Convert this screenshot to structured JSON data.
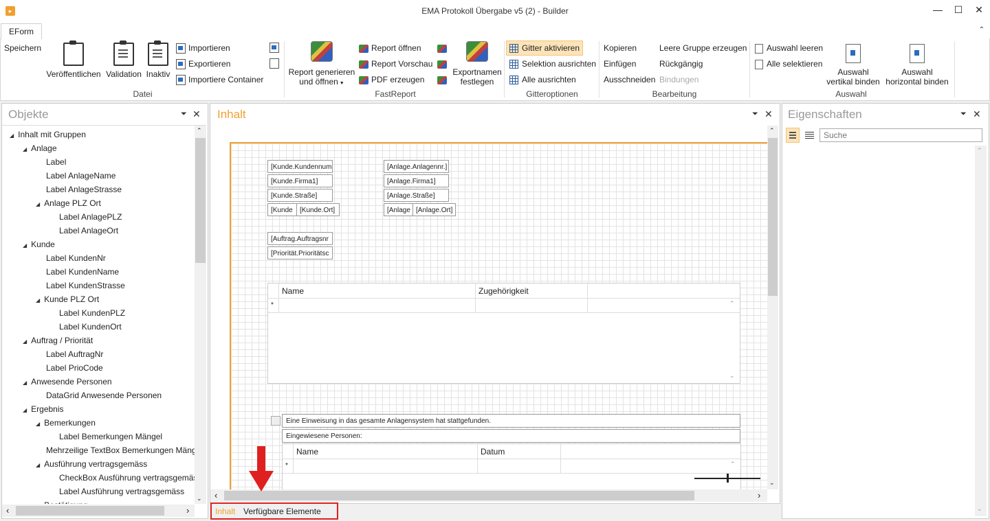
{
  "window": {
    "title": "EMA Protokoll Übergabe v5 (2) - Builder",
    "minimize": "—",
    "maximize": "☐",
    "close": "✕"
  },
  "ribbon": {
    "tab": "EForm",
    "datei": {
      "label": "Datei",
      "speichern": "Speichern",
      "veroeffentlichen": "Veröffentlichen",
      "validation": "Validation",
      "inaktiv": "Inaktiv",
      "importieren": "Importieren",
      "exportieren": "Exportieren",
      "importiere_container": "Importiere Container"
    },
    "fastreport": {
      "label": "FastReport",
      "report_generieren_1": "Report generieren",
      "report_generieren_2": "und öffnen",
      "report_oeffnen": "Report öffnen",
      "report_vorschau": "Report Vorschau",
      "pdf_erzeugen": "PDF erzeugen",
      "exportnamen_1": "Exportnamen",
      "exportnamen_2": "festlegen"
    },
    "gitteroptionen": {
      "label": "Gitteroptionen",
      "gitter_aktivieren": "Gitter aktivieren",
      "selektion_ausrichten": "Selektion ausrichten",
      "alle_ausrichten": "Alle ausrichten"
    },
    "bearbeitung": {
      "label": "Bearbeitung",
      "kopieren": "Kopieren",
      "einfuegen": "Einfügen",
      "ausschneiden": "Ausschneiden",
      "leere_gruppe": "Leere Gruppe erzeugen",
      "rueckgaengig": "Rückgängig",
      "bindungen": "Bindungen"
    },
    "auswahl": {
      "label": "Auswahl",
      "auswahl_leeren": "Auswahl leeren",
      "alle_selektieren": "Alle selektieren",
      "vertikal_1": "Auswahl",
      "vertikal_2": "vertikal binden",
      "horizontal_1": "Auswahl",
      "horizontal_2": "horizontal binden"
    }
  },
  "objekte": {
    "title": "Objekte",
    "items": [
      {
        "label": "Inhalt mit Gruppen",
        "expanded": true
      },
      {
        "label": "Anlage",
        "expanded": true
      },
      {
        "label": "Label"
      },
      {
        "label": "Label AnlageName"
      },
      {
        "label": "Label AnlageStrasse"
      },
      {
        "label": "Anlage PLZ Ort",
        "expanded": true
      },
      {
        "label": "Label AnlagePLZ"
      },
      {
        "label": "Label AnlageOrt"
      },
      {
        "label": "Kunde",
        "expanded": true
      },
      {
        "label": "Label KundenNr"
      },
      {
        "label": "Label KundenName"
      },
      {
        "label": "Label KundenStrasse"
      },
      {
        "label": "Kunde PLZ Ort",
        "expanded": true
      },
      {
        "label": "Label KundenPLZ"
      },
      {
        "label": "Label KundenOrt"
      },
      {
        "label": "Auftrag / Priorität",
        "expanded": true
      },
      {
        "label": "Label AuftragNr"
      },
      {
        "label": "Label PrioCode"
      },
      {
        "label": "Anwesende Personen",
        "expanded": true
      },
      {
        "label": "DataGrid Anwesende Personen"
      },
      {
        "label": "Ergebnis",
        "expanded": true
      },
      {
        "label": "Bemerkungen",
        "expanded": true
      },
      {
        "label": "Label Bemerkungen Mängel"
      },
      {
        "label": "Mehrzeilige TextBox Bemerkungen Mäng"
      },
      {
        "label": "Ausführung vertragsgemäss",
        "expanded": true
      },
      {
        "label": "CheckBox Ausführung vertragsgemäs"
      },
      {
        "label": "Label Ausführung vertragsgemäss"
      },
      {
        "label": "Bestätigung",
        "expanded": true
      }
    ]
  },
  "inhalt": {
    "title": "Inhalt",
    "fields_left": [
      "[Kunde.Kundennum",
      "[Kunde.Firma1]",
      "[Kunde.Straße]",
      "[Kunde",
      "[Kunde.Ort]",
      "[Auftrag.Auftragsnr",
      "[Priorität.Prioritätsc"
    ],
    "fields_right": [
      "[Anlage.Anlagennr.]",
      "[Anlage.Firma1]",
      "[Anlage.Straße]",
      "[Anlage",
      "[Anlage.Ort]"
    ],
    "grid1": {
      "col1": "Name",
      "col2": "Zugehörigkeit",
      "new_row": "*"
    },
    "einweisung": "Eine Einweisung in das gesamte Anlagensystem hat stattgefunden.",
    "eingewiesene": "Eingewiesene Personen:",
    "grid2": {
      "col1": "Name",
      "col2": "Datum",
      "new_row": "*"
    },
    "bottom_tabs": [
      "Inhalt",
      "Verfügbare Elemente"
    ]
  },
  "eigenschaften": {
    "title": "Eigenschaften",
    "search_placeholder": "Suche"
  },
  "colors": {
    "accent": "#f0a030",
    "highlight_red": "#e02020",
    "active_button": "#fce4b8"
  }
}
